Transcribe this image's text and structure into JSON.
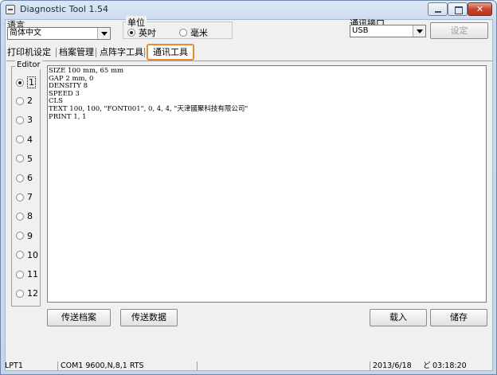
{
  "window": {
    "title": "Diagnostic Tool 1.54",
    "close_glyph": "✕"
  },
  "language": {
    "label": "语言",
    "selected": "简体中文"
  },
  "unit": {
    "label": "单位",
    "options": [
      {
        "label": "英吋",
        "selected": true
      },
      {
        "label": "毫米",
        "selected": false
      }
    ]
  },
  "port": {
    "label": "通讯接口",
    "selected": "USB",
    "set_label": "设定"
  },
  "tabs": {
    "items": [
      "打印机设定",
      "档案管理",
      "点阵字工具"
    ],
    "active": "通讯工具"
  },
  "editor": {
    "label": "Editor",
    "radios": [
      {
        "n": "1",
        "selected": true
      },
      {
        "n": "2"
      },
      {
        "n": "3"
      },
      {
        "n": "4"
      },
      {
        "n": "5"
      },
      {
        "n": "6"
      },
      {
        "n": "7"
      },
      {
        "n": "8"
      },
      {
        "n": "9"
      },
      {
        "n": "10"
      },
      {
        "n": "11"
      },
      {
        "n": "12"
      }
    ],
    "content": "SIZE 100 mm, 65 mm\nGAP 2 mm, 0\nDENSITY 8\nSPEED 3\nCLS\nTEXT 100, 100, \"FONT001\", 0, 4, 4, \"天津國聚科技有限公司\"\nPRINT 1, 1"
  },
  "actions": {
    "send_file": "传送档案",
    "send_data": "传送数据",
    "load": "载入",
    "save": "储存"
  },
  "status": {
    "port": "LPT1",
    "com": "COM1 9600,N,8,1 RTS",
    "date": "2013/6/18",
    "time": "03:18:20"
  }
}
